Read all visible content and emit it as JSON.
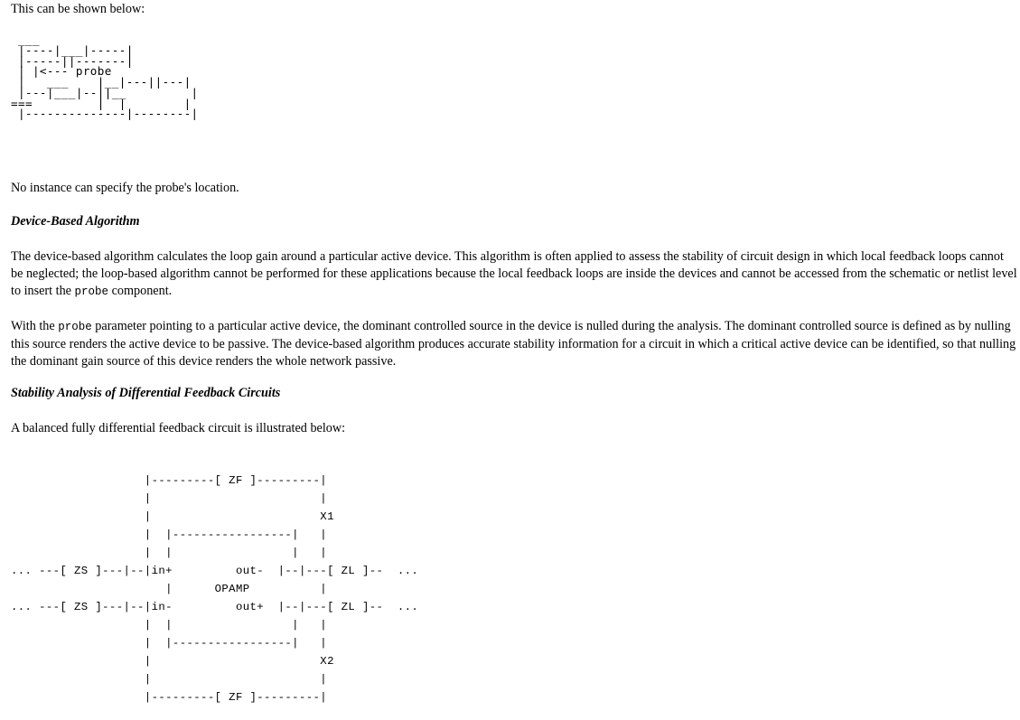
{
  "intro_text": "This can be shown below:",
  "diagram1": " ___\n |----|___|-----|\n |-----||-------|\n | |<--- probe\n |   ___    |__|---||---|\n |---|___|--||__         |\n===         |  |        |\n |--------------|--------|",
  "no_instance_text": "No instance can specify the probe's location.",
  "heading_device_based": "Device-Based Algorithm",
  "para1": {
    "before": "The device-based algorithm calculates the loop gain around a particular active device. This algorithm is often applied to assess the stability of circuit design in which local feedback loops cannot be neglected; the loop-based algorithm cannot be performed for these applications because the local feedback loops are inside the devices and cannot be accessed from the schematic or netlist level to insert the ",
    "code": "probe",
    "after": " component."
  },
  "para2": {
    "before": "With the ",
    "code": "probe",
    "after": " parameter pointing to a particular active device, the dominant controlled source in the device is nulled during the analysis. The dominant controlled source is defined as by nulling this source renders the active device to be passive. The device-based algorithm produces accurate stability information for a circuit in which a critical active device can be identified, so that nulling the dominant gain source of this device renders the whole network passive."
  },
  "heading_differential": "Stability Analysis of Differential Feedback Circuits",
  "balanced_text": "A balanced fully differential feedback circuit is illustrated below:",
  "diagram2": "                   |---------[ ZF ]---------|\n                   |                        |\n                   |                        X1\n                   |  |-----------------|   |\n                   |  |                 |   |\n... ---[ ZS ]---|--|in+         out-  |--|---[ ZL ]--  ...\n                      |      OPAMP          |\n... ---[ ZS ]---|--|in-         out+  |--|---[ ZL ]--  ...\n                   |  |                 |   |\n                   |  |-----------------|   |\n                   |                        X2\n                   |                        |\n                   |---------[ ZF ]---------|"
}
